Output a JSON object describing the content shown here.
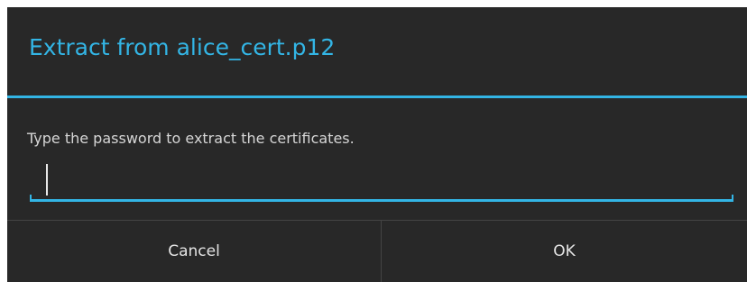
{
  "dialog": {
    "title": "Extract from alice_cert.p12",
    "message": "Type the password to extract the certificates.",
    "password_value": "",
    "cancel_label": "Cancel",
    "ok_label": "OK"
  },
  "colors": {
    "accent": "#33b5e5",
    "background": "#282828",
    "text": "#d6d6d6"
  }
}
